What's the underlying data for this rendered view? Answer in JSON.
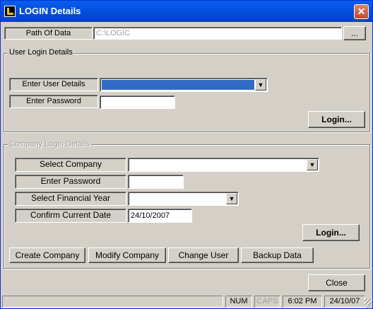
{
  "window": {
    "title": "LOGIN Details",
    "close_glyph": "✕"
  },
  "path": {
    "label": "Path Of Data",
    "value": "C:\\LOGIC",
    "browse_label": "..."
  },
  "user_login": {
    "group_title": "User Login Details",
    "user_label": "Enter User Details",
    "user_value": "",
    "password_label": "Enter Password",
    "password_value": "",
    "login_label": "Login..."
  },
  "company_login": {
    "group_title": "Company Login Details",
    "company_label": "Select Company",
    "company_value": "",
    "password_label": "Enter Password",
    "password_value": "",
    "year_label": "Select Financial Year",
    "year_value": "",
    "date_label": "Confirm Current Date",
    "date_value": "24/10/2007",
    "login_label": "Login..."
  },
  "actions": {
    "create_company": "Create Company",
    "modify_company": "Modify Company",
    "change_user": "Change User",
    "backup_data": "Backup Data",
    "close": "Close"
  },
  "statusbar": {
    "num": "NUM",
    "caps": "CAPS",
    "time": "6:02 PM",
    "date": "24/10/07"
  },
  "colors": {
    "titlebar": "#0452e1",
    "selection": "#316ac5",
    "face": "#d4d0c8"
  }
}
